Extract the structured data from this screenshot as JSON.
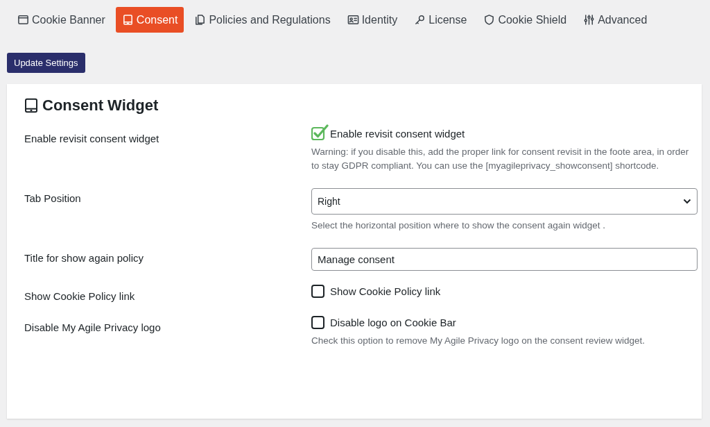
{
  "tabs": [
    {
      "label": "Cookie Banner",
      "selected": false
    },
    {
      "label": "Consent",
      "selected": true
    },
    {
      "label": "Policies and Regulations",
      "selected": false
    },
    {
      "label": "Identity",
      "selected": false
    },
    {
      "label": "License",
      "selected": false
    },
    {
      "label": "Cookie Shield",
      "selected": false
    },
    {
      "label": "Advanced",
      "selected": false
    }
  ],
  "update_button": "Update Settings",
  "card": {
    "title": "Consent Widget",
    "rows": [
      {
        "kind": "checkbox",
        "label": "Enable revisit consent widget",
        "option": "Enable revisit consent widget",
        "checked": true,
        "help": "Warning: if you disable this, add the proper link for consent revisit in the foote area, in order to stay GDPR compliant. You can use the [myagileprivacy_showconsent] shortcode."
      },
      {
        "kind": "select",
        "label": "Tab Position",
        "value": "Right",
        "help": "Select the horizontal position where to show the consent again widget ."
      },
      {
        "kind": "text",
        "label": "Title for show again policy",
        "value": "Manage consent"
      },
      {
        "kind": "checkbox",
        "label": "Show Cookie Policy link",
        "option": "Show Cookie Policy link",
        "checked": false
      },
      {
        "kind": "checkbox",
        "label": "Disable My Agile Privacy logo",
        "option": "Disable logo on Cookie Bar",
        "checked": false,
        "help": "Check this option to remove My Agile Privacy logo on the consent review widget."
      }
    ]
  }
}
